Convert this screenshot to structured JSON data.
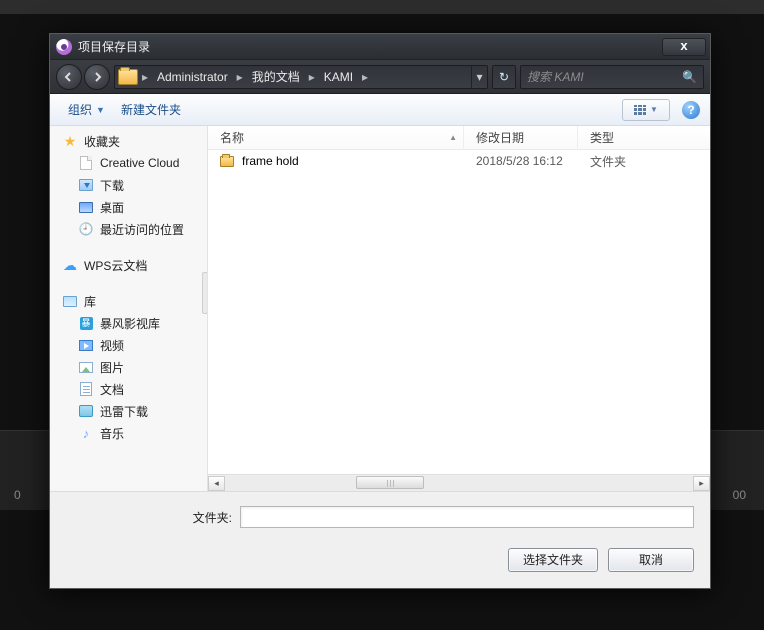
{
  "background": {
    "left_num": "0",
    "right_num": "00"
  },
  "dialog": {
    "title": "项目保存目录",
    "breadcrumb": [
      "Administrator",
      "我的文档",
      "KAMI"
    ],
    "search_placeholder": "搜索 KAMI",
    "toolbar": {
      "organize": "组织",
      "new_folder": "新建文件夹"
    },
    "columns": {
      "name": "名称",
      "modified": "修改日期",
      "type": "类型"
    },
    "rows": [
      {
        "name": "frame hold",
        "modified": "2018/5/28 16:12",
        "type": "文件夹"
      }
    ],
    "tree": {
      "favorites": "收藏夹",
      "fav_items": [
        "Creative Cloud",
        "下载",
        "桌面",
        "最近访问的位置"
      ],
      "wps": "WPS云文档",
      "libraries": "库",
      "lib_items": [
        "暴风影视库",
        "视频",
        "图片",
        "文档",
        "迅雷下载",
        "音乐"
      ]
    },
    "footer": {
      "folder_label": "文件夹:",
      "folder_value": "",
      "select_btn": "选择文件夹",
      "cancel_btn": "取消"
    }
  }
}
